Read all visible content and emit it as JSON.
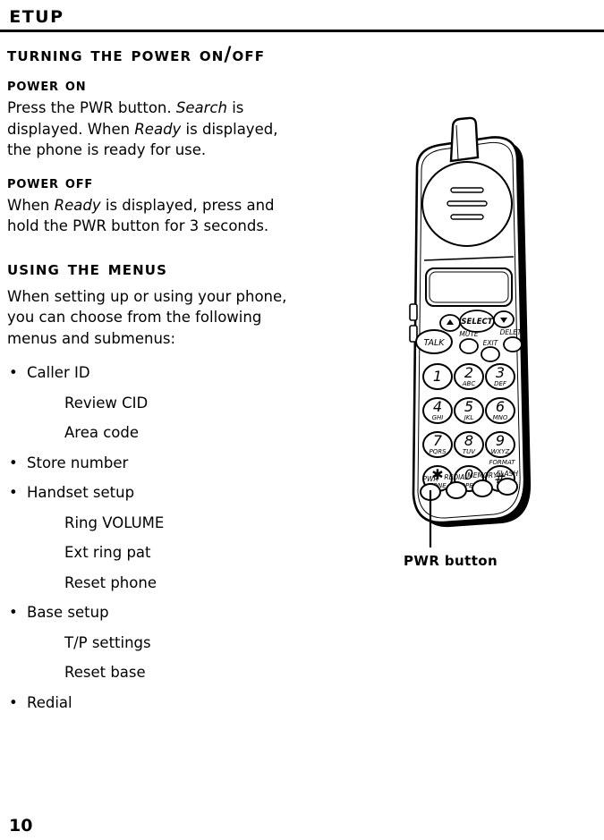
{
  "page": {
    "chapter_title": "Setup",
    "page_number": "10"
  },
  "sections": {
    "main_heading": "Turning the Power ON/OFF",
    "power_on": {
      "heading": "Power ON",
      "body_part1": "Press the PWR button. ",
      "body_em1": "Search",
      "body_part2": " is displayed. When ",
      "body_em2": "Ready",
      "body_part3": " is displayed, the phone is ready for use."
    },
    "power_off": {
      "heading": "Power OFF",
      "body_part1": "When ",
      "body_em1": "Ready",
      "body_part2": " is displayed, press and hold the PWR button for 3 seconds."
    },
    "using_menus": {
      "heading": "Using the Menus",
      "intro": "When setting up or using your phone, you can choose from the following menus and submenus:",
      "items": [
        {
          "type": "bullet",
          "label": "Caller ID"
        },
        {
          "type": "subitem",
          "label": "Review CID"
        },
        {
          "type": "subitem",
          "label": "Area code"
        },
        {
          "type": "bullet",
          "label": "Store number"
        },
        {
          "type": "bullet",
          "label": "Handset setup"
        },
        {
          "type": "subitem",
          "label": "Ring VOLUME"
        },
        {
          "type": "subitem",
          "label": "Ext ring pat"
        },
        {
          "type": "subitem",
          "label": "Reset phone"
        },
        {
          "type": "bullet",
          "label": "Base setup"
        },
        {
          "type": "subitem",
          "label": "T/P settings"
        },
        {
          "type": "subitem",
          "label": "Reset base"
        },
        {
          "type": "bullet",
          "label": "Redial"
        }
      ]
    }
  },
  "figure": {
    "callout_label": "PWR button",
    "nav_buttons": {
      "up": "▲",
      "select": "SELECT",
      "down": "▼"
    },
    "function_buttons": {
      "talk": "TALK",
      "mute": "MUTE",
      "exit": "EXIT",
      "delete": "DELETE"
    },
    "keypad": [
      {
        "digit": "1",
        "letters": ""
      },
      {
        "digit": "2",
        "letters": "ABC"
      },
      {
        "digit": "3",
        "letters": "DEF"
      },
      {
        "digit": "4",
        "letters": "GHI"
      },
      {
        "digit": "5",
        "letters": "JKL"
      },
      {
        "digit": "6",
        "letters": "MNO"
      },
      {
        "digit": "7",
        "letters": "PQRS"
      },
      {
        "digit": "8",
        "letters": "TUV"
      },
      {
        "digit": "9",
        "letters": "WXYZ",
        "extra": "FORMAT"
      },
      {
        "digit": "✱",
        "letters": "TONE"
      },
      {
        "digit": "0",
        "letters": "OPER"
      },
      {
        "digit": "#",
        "letters": ""
      }
    ],
    "bottom_buttons": [
      "PWR",
      "REDIAL",
      "MEMORY",
      "FLASH"
    ]
  },
  "colors": {
    "ink": "#000000",
    "paper": "#ffffff",
    "shadow": "#000000"
  }
}
